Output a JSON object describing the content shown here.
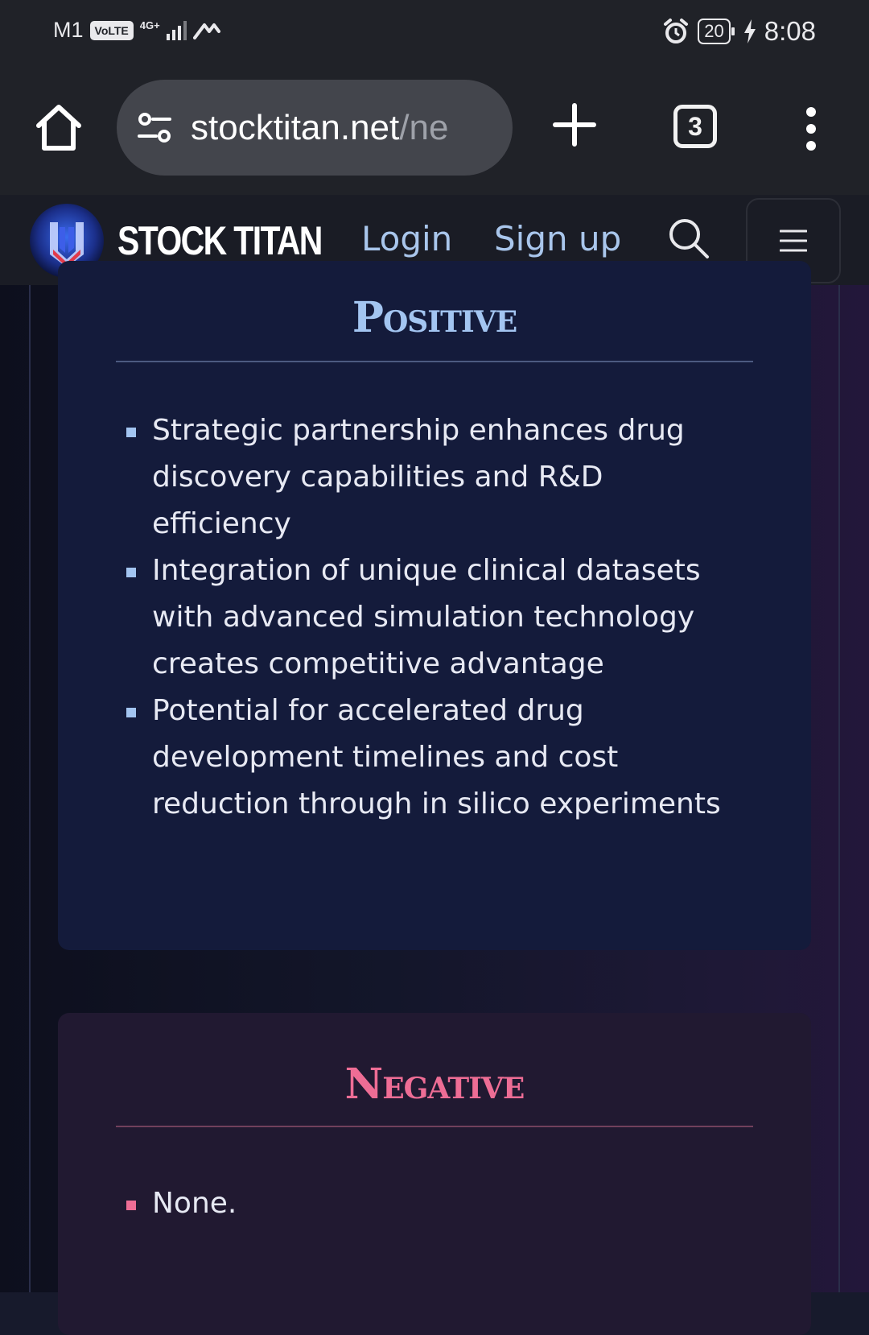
{
  "status_bar": {
    "carrier": "M1",
    "volte": "VoLTE",
    "network": "4G+",
    "time": "8:08",
    "battery": "20"
  },
  "browser": {
    "url_host": "stocktitan.net",
    "url_rest": "/ne",
    "tab_count": "3"
  },
  "site_header": {
    "brand": "STOCK TITAN",
    "login": "Login",
    "signup": "Sign up"
  },
  "positive": {
    "title": "Positive",
    "items": [
      "Strategic partnership enhances drug discovery capabilities and R&D efficiency",
      "Integration of unique clinical datasets with advanced simulation technology creates competitive advantage",
      "Potential for accelerated drug development timelines and cost reduction through in silico experiments"
    ]
  },
  "negative": {
    "title": "Negative",
    "items": [
      "None."
    ]
  },
  "colors": {
    "positive_accent": "#a3c5f1",
    "negative_accent": "#ee6d95",
    "link": "#a9c6ec"
  }
}
